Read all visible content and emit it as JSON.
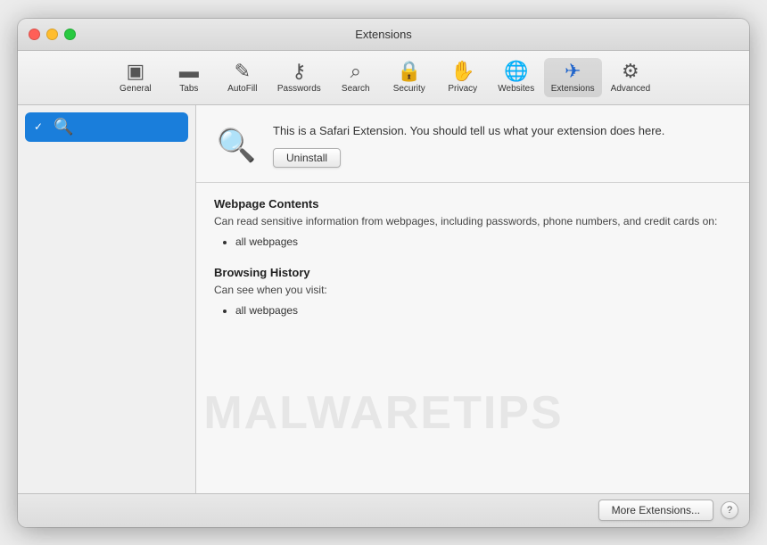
{
  "window": {
    "title": "Extensions"
  },
  "toolbar": {
    "items": [
      {
        "id": "general",
        "label": "General",
        "icon": "▣",
        "active": false
      },
      {
        "id": "tabs",
        "label": "Tabs",
        "icon": "▬",
        "active": false
      },
      {
        "id": "autofill",
        "label": "AutoFill",
        "icon": "✎",
        "active": false
      },
      {
        "id": "passwords",
        "label": "Passwords",
        "icon": "⚷",
        "active": false
      },
      {
        "id": "search",
        "label": "Search",
        "icon": "⌕",
        "active": false
      },
      {
        "id": "security",
        "label": "Security",
        "icon": "⊕",
        "active": false
      },
      {
        "id": "privacy",
        "label": "Privacy",
        "icon": "✋",
        "active": false
      },
      {
        "id": "websites",
        "label": "Websites",
        "icon": "🌐",
        "active": false
      },
      {
        "id": "extensions",
        "label": "Extensions",
        "icon": "⎋",
        "active": true
      },
      {
        "id": "advanced",
        "label": "Advanced",
        "icon": "⚙",
        "active": false
      }
    ]
  },
  "sidebar": {
    "items": [
      {
        "id": "search-ext",
        "label": "",
        "checked": true,
        "icon": "🔍"
      }
    ]
  },
  "detail": {
    "description": "This is a Safari Extension. You should tell us what your extension does here.",
    "uninstall_label": "Uninstall",
    "permissions": [
      {
        "title": "Webpage Contents",
        "desc": "Can read sensitive information from webpages, including passwords, phone numbers, and credit cards on:",
        "items": [
          "all webpages"
        ]
      },
      {
        "title": "Browsing History",
        "desc": "Can see when you visit:",
        "items": [
          "all webpages"
        ]
      }
    ]
  },
  "bottom_bar": {
    "more_extensions_label": "More Extensions...",
    "help_label": "?"
  },
  "watermark": {
    "text": "MALWARETIPS"
  }
}
